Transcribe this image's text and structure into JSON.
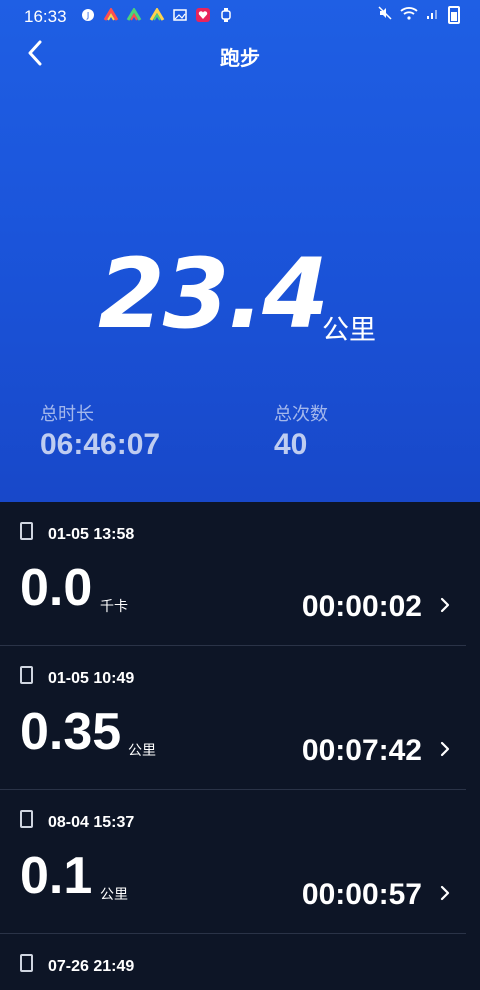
{
  "status_bar": {
    "time": "16:33",
    "notification_icons": [
      "notification-icon-1",
      "notification-icon-2",
      "notification-icon-3",
      "notification-icon-4",
      "image-icon",
      "heart-app-icon",
      "watch-icon"
    ],
    "system_icons": [
      "mute-icon",
      "wifi-icon",
      "signal-icon",
      "battery-icon"
    ]
  },
  "header": {
    "back_icon": "chevron-left-icon",
    "title": "跑步"
  },
  "summary": {
    "distance": "23.4",
    "distance_unit": "公里",
    "total_duration_label": "总时长",
    "total_duration_value": "06:46:07",
    "total_count_label": "总次数",
    "total_count_value": "40"
  },
  "records": [
    {
      "device_icon": "phone-icon",
      "date": "01-05 13:58",
      "value": "0.0",
      "unit": "千卡",
      "duration": "00:00:02"
    },
    {
      "device_icon": "phone-icon",
      "date": "01-05 10:49",
      "value": "0.35",
      "unit": "公里",
      "duration": "00:07:42"
    },
    {
      "device_icon": "phone-icon",
      "date": "08-04 15:37",
      "value": "0.1",
      "unit": "公里",
      "duration": "00:00:57"
    },
    {
      "device_icon": "phone-icon",
      "date": "07-26 21:49"
    }
  ],
  "colors": {
    "hero_blue": "#1f5fe4",
    "list_background": "#0d1526",
    "divider": "#2a3347",
    "text": "#ffffff"
  }
}
